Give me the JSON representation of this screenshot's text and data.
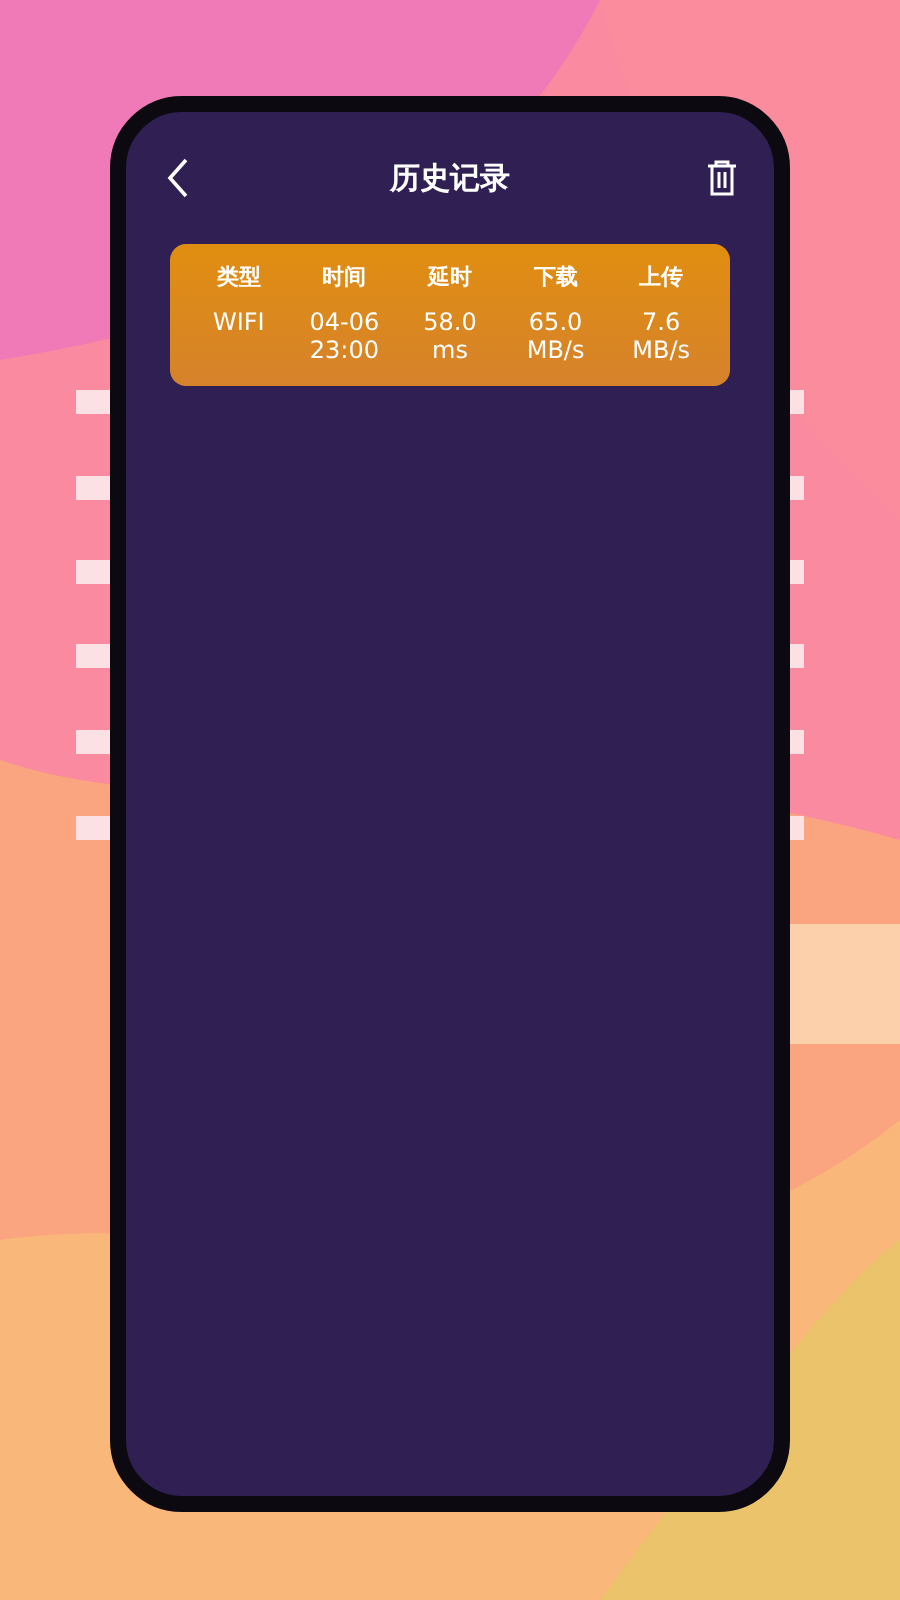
{
  "screen": {
    "title": "历史记录"
  },
  "history_table": {
    "columns": [
      "类型",
      "时间",
      "延时",
      "下载",
      "上传"
    ],
    "rows": [
      {
        "cells": [
          "WIFI",
          "04-06\n23:00",
          "58.0\nms",
          "65.0\nMB/s",
          "7.6\nMB/s"
        ]
      }
    ]
  }
}
